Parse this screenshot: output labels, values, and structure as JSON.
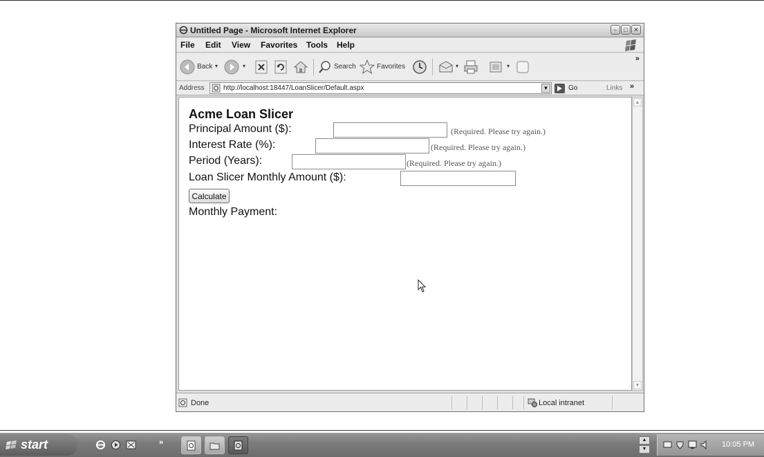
{
  "browser": {
    "title": "Untitled Page - Microsoft Internet Explorer",
    "menu": [
      "File",
      "Edit",
      "View",
      "Favorites",
      "Tools",
      "Help"
    ],
    "toolbar": {
      "back_label": "Back",
      "search_label": "Search",
      "favorites_label": "Favorites",
      "overflow": "»"
    },
    "address": {
      "label": "Address",
      "url": "http://localhost:18447/LoanSlicer/Default.aspx",
      "go_label": "Go",
      "links_label": "Links",
      "links_overflow": "»"
    },
    "status": {
      "text": "Done",
      "zone": "Local intranet"
    }
  },
  "page": {
    "heading": "Acme Loan Slicer",
    "fields": {
      "principal": {
        "label": "Principal Amount ($):",
        "value": "",
        "validator": "(Required. Please try again.)"
      },
      "interest": {
        "label": "Interest Rate (%):",
        "value": "",
        "validator": "(Required. Please try again.)"
      },
      "period": {
        "label": "Period (Years):",
        "value": "",
        "validator": "(Required. Please try again.)"
      },
      "monthly": {
        "label": "Loan Slicer Monthly Amount ($):",
        "value": ""
      }
    },
    "calculate_label": "Calculate",
    "monthly_payment_label": "Monthly Payment:"
  },
  "taskbar": {
    "start_label": "start",
    "quicklaunch_overflow": "»",
    "clock": "10:05 PM"
  }
}
